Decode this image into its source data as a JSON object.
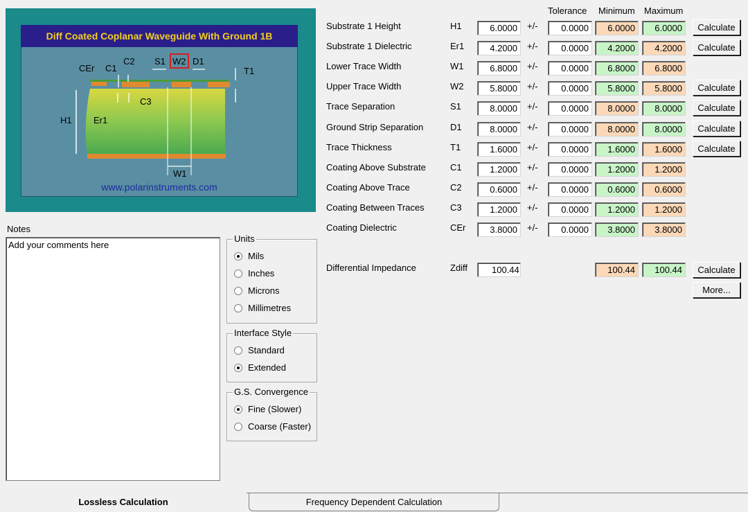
{
  "diagram": {
    "title": "Diff Coated Coplanar Waveguide With Ground 1B",
    "url": "www.polarinstruments.com",
    "labels": {
      "CEr": "CEr",
      "C1": "C1",
      "C2": "C2",
      "S1": "S1",
      "W2": "W2",
      "D1": "D1",
      "T1": "T1",
      "C3": "C3",
      "H1": "H1",
      "Er1": "Er1",
      "W1": "W1"
    }
  },
  "headers": {
    "tolerance": "Tolerance",
    "minimum": "Minimum",
    "maximum": "Maximum"
  },
  "pm": "+/-",
  "calculate_label": "Calculate",
  "more_label": "More...",
  "params": [
    {
      "label": "Substrate 1 Height",
      "sym": "H1",
      "value": "6.0000",
      "tol": "0.0000",
      "min": "6.0000",
      "max": "6.0000",
      "min_color": "orange",
      "max_color": "green",
      "calc": true
    },
    {
      "label": "Substrate 1 Dielectric",
      "sym": "Er1",
      "value": "4.2000",
      "tol": "0.0000",
      "min": "4.2000",
      "max": "4.2000",
      "min_color": "green",
      "max_color": "orange",
      "calc": true
    },
    {
      "label": "Lower Trace Width",
      "sym": "W1",
      "value": "6.8000",
      "tol": "0.0000",
      "min": "6.8000",
      "max": "6.8000",
      "min_color": "green",
      "max_color": "orange",
      "calc": false
    },
    {
      "label": "Upper Trace Width",
      "sym": "W2",
      "value": "5.8000",
      "tol": "0.0000",
      "min": "5.8000",
      "max": "5.8000",
      "min_color": "green",
      "max_color": "orange",
      "calc": true
    },
    {
      "label": "Trace Separation",
      "sym": "S1",
      "value": "8.0000",
      "tol": "0.0000",
      "min": "8.0000",
      "max": "8.0000",
      "min_color": "orange",
      "max_color": "green",
      "calc": true
    },
    {
      "label": "Ground Strip Separation",
      "sym": "D1",
      "value": "8.0000",
      "tol": "0.0000",
      "min": "8.0000",
      "max": "8.0000",
      "min_color": "orange",
      "max_color": "green",
      "calc": true
    },
    {
      "label": "Trace Thickness",
      "sym": "T1",
      "value": "1.6000",
      "tol": "0.0000",
      "min": "1.6000",
      "max": "1.6000",
      "min_color": "green",
      "max_color": "orange",
      "calc": true
    },
    {
      "label": "Coating Above Substrate",
      "sym": "C1",
      "value": "1.2000",
      "tol": "0.0000",
      "min": "1.2000",
      "max": "1.2000",
      "min_color": "green",
      "max_color": "orange",
      "calc": false
    },
    {
      "label": "Coating Above Trace",
      "sym": "C2",
      "value": "0.6000",
      "tol": "0.0000",
      "min": "0.6000",
      "max": "0.6000",
      "min_color": "green",
      "max_color": "orange",
      "calc": false
    },
    {
      "label": "Coating Between Traces",
      "sym": "C3",
      "value": "1.2000",
      "tol": "0.0000",
      "min": "1.2000",
      "max": "1.2000",
      "min_color": "green",
      "max_color": "orange",
      "calc": false
    },
    {
      "label": "Coating Dielectric",
      "sym": "CEr",
      "value": "3.8000",
      "tol": "0.0000",
      "min": "3.8000",
      "max": "3.8000",
      "min_color": "green",
      "max_color": "orange",
      "calc": false
    }
  ],
  "zdiff": {
    "label": "Differential Impedance",
    "sym": "Zdiff",
    "value": "100.44",
    "min": "100.44",
    "max": "100.44"
  },
  "notes": {
    "label": "Notes",
    "text": "Add your comments here"
  },
  "units": {
    "title": "Units",
    "options": [
      "Mils",
      "Inches",
      "Microns",
      "Millimetres"
    ],
    "selected": "Mils"
  },
  "interface": {
    "title": "Interface Style",
    "options": [
      "Standard",
      "Extended"
    ],
    "selected": "Extended"
  },
  "convergence": {
    "title": "G.S. Convergence",
    "options": [
      "Fine (Slower)",
      "Coarse (Faster)"
    ],
    "selected": "Fine (Slower)"
  },
  "tabs": {
    "lossless": "Lossless Calculation",
    "frequency": "Frequency Dependent Calculation"
  },
  "colors": {
    "orange": "#fbd8b8",
    "green": "#c8f4c8",
    "diagram_bg": "#1a8a8a",
    "title_bg": "#2a1e8a",
    "title_fg": "#f2d020"
  }
}
